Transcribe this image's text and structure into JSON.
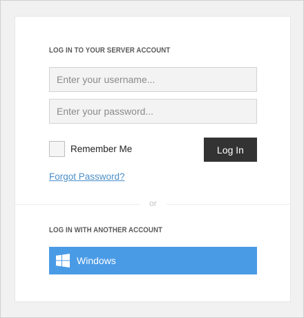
{
  "login": {
    "server_heading": "LOG IN TO YOUR SERVER ACCOUNT",
    "username_placeholder": "Enter your username...",
    "password_placeholder": "Enter your password...",
    "remember_label": "Remember Me",
    "remember_checked": false,
    "login_button": "Log In",
    "forgot_link": "Forgot Password?"
  },
  "divider": {
    "text": "or"
  },
  "alt_login": {
    "heading": "LOG IN WITH ANOTHER ACCOUNT",
    "windows_button": "Windows",
    "windows_icon": "windows-logo-icon"
  },
  "colors": {
    "login_button_bg": "#333333",
    "windows_button_bg": "#4a9be6",
    "link": "#4a8ec8"
  }
}
